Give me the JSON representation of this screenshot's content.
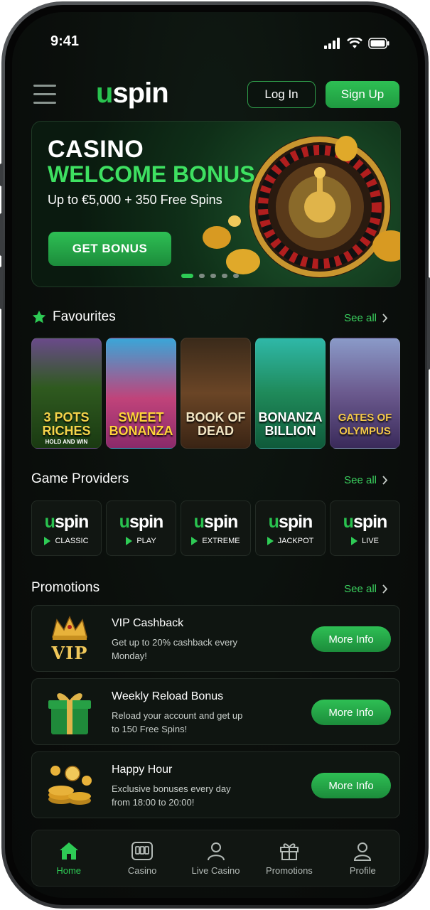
{
  "status_bar": {
    "time": "9:41"
  },
  "header": {
    "logo": {
      "prefix": "u",
      "rest": "spin"
    },
    "login_label": "Log In",
    "signup_label": "Sign Up"
  },
  "hero": {
    "title_line1": "CASINO",
    "title_line2": "WELCOME BONUS",
    "subtitle": "Up to €5,000 + 350 Free Spins",
    "cta_label": "GET BONUS",
    "slides_count": 5,
    "active_slide": 1
  },
  "favourites": {
    "title": "Favourites",
    "see_all": "See all",
    "games": [
      {
        "name": "3 POTS RICHES",
        "sub": "HOLD AND WIN",
        "bg": "#2f5a1f"
      },
      {
        "name": "SWEET BONANZA",
        "sub": "",
        "bg": "#c0437a"
      },
      {
        "name": "BOOK OF DEAD",
        "sub": "",
        "bg": "#6a4526"
      },
      {
        "name": "BONANZA BILLION",
        "sub": "",
        "bg": "#1f8a5a"
      },
      {
        "name": "GATES OF OLYMPUS",
        "sub": "",
        "bg": "#6b5a8e"
      }
    ]
  },
  "providers": {
    "title": "Game Providers",
    "see_all": "See all",
    "items": [
      {
        "logo_prefix": "u",
        "logo_rest": "spin",
        "tag": "CLASSIC"
      },
      {
        "logo_prefix": "u",
        "logo_rest": "spin",
        "tag": "PLAY"
      },
      {
        "logo_prefix": "u",
        "logo_rest": "spin",
        "tag": "EXTREME"
      },
      {
        "logo_prefix": "u",
        "logo_rest": "spin",
        "tag": "JACKPOT"
      },
      {
        "logo_prefix": "u",
        "logo_rest": "spin",
        "tag": "LIVE"
      }
    ]
  },
  "promotions": {
    "title": "Promotions",
    "see_all": "See all",
    "items": [
      {
        "title": "VIP Cashback",
        "desc": "Get up to 20% cashback every Monday!",
        "button": "More Info",
        "icon": "crown-vip-icon",
        "icon_text": "VIP"
      },
      {
        "title": "Weekly Reload Bonus",
        "desc": "Reload your account and get up to 150 Free Spins!",
        "button": "More Info",
        "icon": "gift-box-icon"
      },
      {
        "title": "Happy Hour",
        "desc": "Exclusive bonuses every day from 18:00 to 20:00!",
        "button": "More Info",
        "icon": "gold-coins-icon"
      }
    ]
  },
  "bottom_nav": {
    "items": [
      {
        "label": "Home",
        "icon": "home-icon",
        "active": true
      },
      {
        "label": "Casino",
        "icon": "slot-machine-icon",
        "active": false
      },
      {
        "label": "Live Casino",
        "icon": "person-icon",
        "active": false
      },
      {
        "label": "Promotions",
        "icon": "gift-icon",
        "active": false
      },
      {
        "label": "Profile",
        "icon": "profile-icon",
        "active": false
      }
    ]
  },
  "colors": {
    "accent": "#2ecb55",
    "background": "#0b0f0c",
    "card": "#111612"
  }
}
